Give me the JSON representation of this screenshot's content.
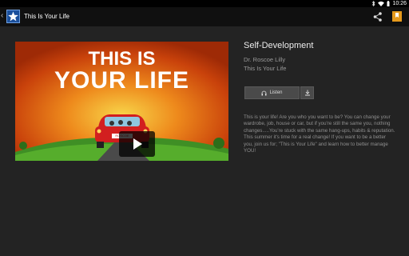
{
  "status_bar": {
    "time": "10:26"
  },
  "action_bar": {
    "back_glyph": "‹",
    "title": "This Is Your Life"
  },
  "thumbnail": {
    "line1": "THIS IS",
    "line2": "YOUR LIFE",
    "plate": "ROSCOE"
  },
  "details": {
    "category": "Self-Development",
    "author": "Dr. Roscoe Lilly",
    "album": "This Is Your Life",
    "listen_label": "Listen",
    "description": "This is your life! Are you who you want to be? You can change your wardrobe, job, house or car, but if you're still the same you, nothing changes.....You're stuck with the same hang-ups, habits & reputation. This summer it's time for a real change! If you want to be a better you, join us for; \"This is Your Life\" and learn how to better manage YOU!"
  },
  "colors": {
    "background": "#232323",
    "actionbar": "#101010",
    "button": "#4a4a4a"
  }
}
